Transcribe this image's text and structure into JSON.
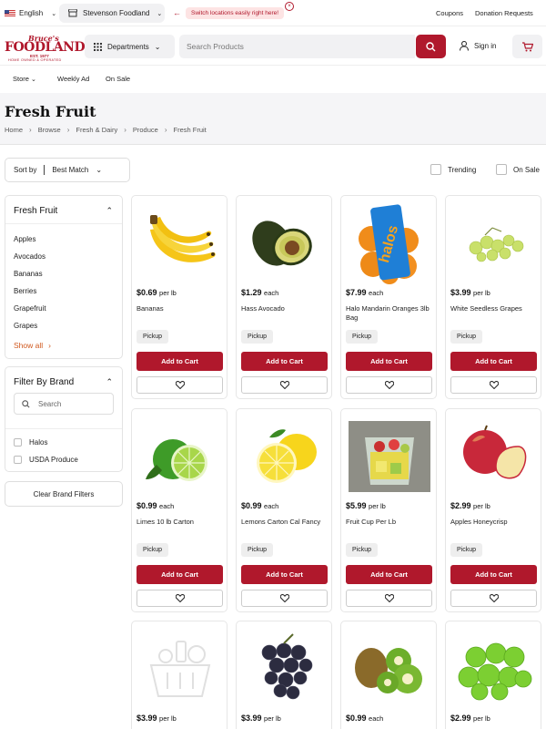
{
  "topbar": {
    "language": "English",
    "store": "Stevenson Foodland",
    "switch_message": "Switch locations easily right here!",
    "coupons": "Coupons",
    "donation": "Donation Requests"
  },
  "header": {
    "logo_script": "Bruce's",
    "logo_name": "FOODLAND",
    "logo_est": "EST. 1977",
    "logo_sub": "HOME OWNED & OPERATED",
    "departments": "Departments",
    "search_placeholder": "Search Products",
    "sign_in": "Sign in"
  },
  "nav": {
    "store": "Store",
    "weekly_ad": "Weekly Ad",
    "on_sale": "On Sale"
  },
  "page": {
    "title": "Fresh Fruit",
    "breadcrumbs": [
      "Home",
      "Browse",
      "Fresh & Dairy",
      "Produce",
      "Fresh Fruit"
    ]
  },
  "sort": {
    "label": "Sort by",
    "value": "Best Match",
    "trending": "Trending",
    "on_sale": "On Sale"
  },
  "sidebar": {
    "category_title": "Fresh Fruit",
    "categories": [
      "Apples",
      "Avocados",
      "Bananas",
      "Berries",
      "Grapefruit",
      "Grapes"
    ],
    "show_all": "Show all",
    "brand_title": "Filter By Brand",
    "brand_search_placeholder": "Search",
    "brands": [
      "Halos",
      "USDA Produce"
    ],
    "clear_brand": "Clear Brand Filters"
  },
  "product_labels": {
    "pickup": "Pickup",
    "add_to_cart": "Add to Cart"
  },
  "products": [
    {
      "price": "$0.69",
      "unit": "per lb",
      "name": "Bananas",
      "icon": "banana-icon"
    },
    {
      "price": "$1.29",
      "unit": "each",
      "name": "Hass Avocado",
      "icon": "avocado-icon"
    },
    {
      "price": "$7.99",
      "unit": "each",
      "name": "Halo Mandarin Oranges 3lb Bag",
      "icon": "halos-bag-icon"
    },
    {
      "price": "$3.99",
      "unit": "per lb",
      "name": "White Seedless Grapes",
      "icon": "green-grapes-icon"
    },
    {
      "price": "$0.99",
      "unit": "each",
      "name": "Limes 10 lb Carton",
      "icon": "lime-icon"
    },
    {
      "price": "$0.99",
      "unit": "each",
      "name": "Lemons Carton Cal Fancy",
      "icon": "lemon-icon"
    },
    {
      "price": "$5.99",
      "unit": "per lb",
      "name": "Fruit Cup Per Lb",
      "icon": "fruit-cup-icon"
    },
    {
      "price": "$2.99",
      "unit": "per lb",
      "name": "Apples Honeycrisp",
      "icon": "red-apple-icon"
    },
    {
      "price": "$3.99",
      "unit": "per lb",
      "name": "",
      "icon": "placeholder-basket-icon"
    },
    {
      "price": "$3.99",
      "unit": "per lb",
      "name": "",
      "icon": "black-grapes-icon"
    },
    {
      "price": "$0.99",
      "unit": "each",
      "name": "",
      "icon": "kiwi-icon"
    },
    {
      "price": "$2.99",
      "unit": "per lb",
      "name": "",
      "icon": "green-apple-icon"
    }
  ],
  "colors": {
    "brand_red": "#b0182c",
    "accent_orange": "#d0581e"
  }
}
